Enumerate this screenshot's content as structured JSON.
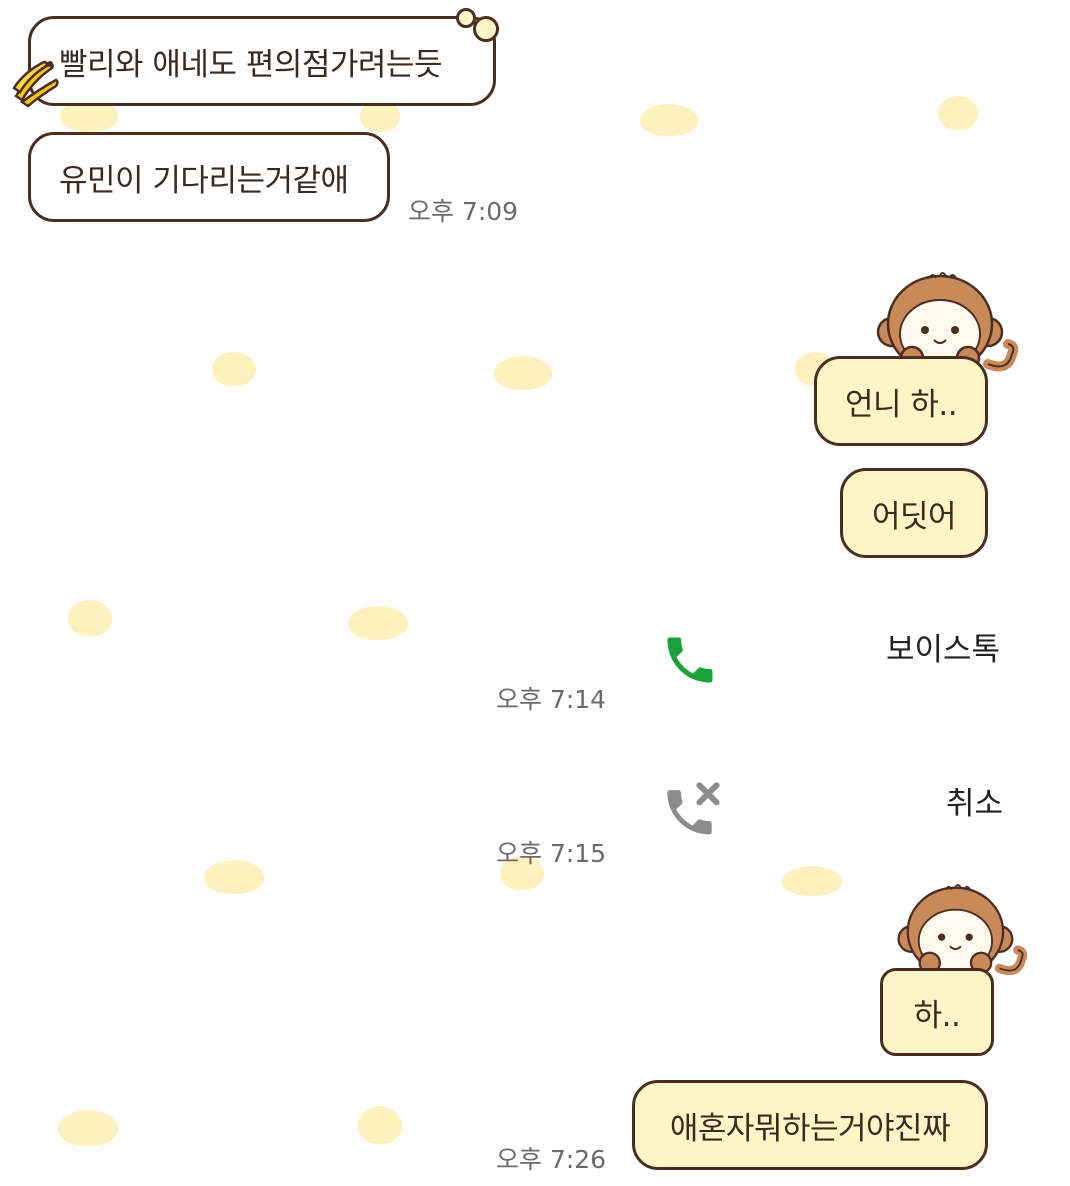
{
  "messages": {
    "m1": "빨리와 애네도 편의점가려는듯",
    "m2": "유민이 기다리는거같애",
    "m3": "언니 하..",
    "m4": "어딧어",
    "m5": "하..",
    "m6": "애혼자뭐하는거야진짜"
  },
  "timestamps": {
    "t1": "오후 7:09",
    "t2": "오후 7:14",
    "t3": "오후 7:15",
    "t4": "오후 7:26"
  },
  "calls": {
    "voice": "보이스톡",
    "cancel": "취소"
  },
  "colors": {
    "bubble_border": "#4a2e22",
    "outgoing_bubble": "#fff5c7",
    "incoming_bubble": "#ffffff",
    "call_green": "#1aa33a",
    "call_gray": "#8c8c8c",
    "wallpaper_banana": "#fdf0b8"
  },
  "icons": [
    "banana-icon",
    "phone-icon",
    "phone-cancel-icon",
    "monkey-sticker"
  ]
}
